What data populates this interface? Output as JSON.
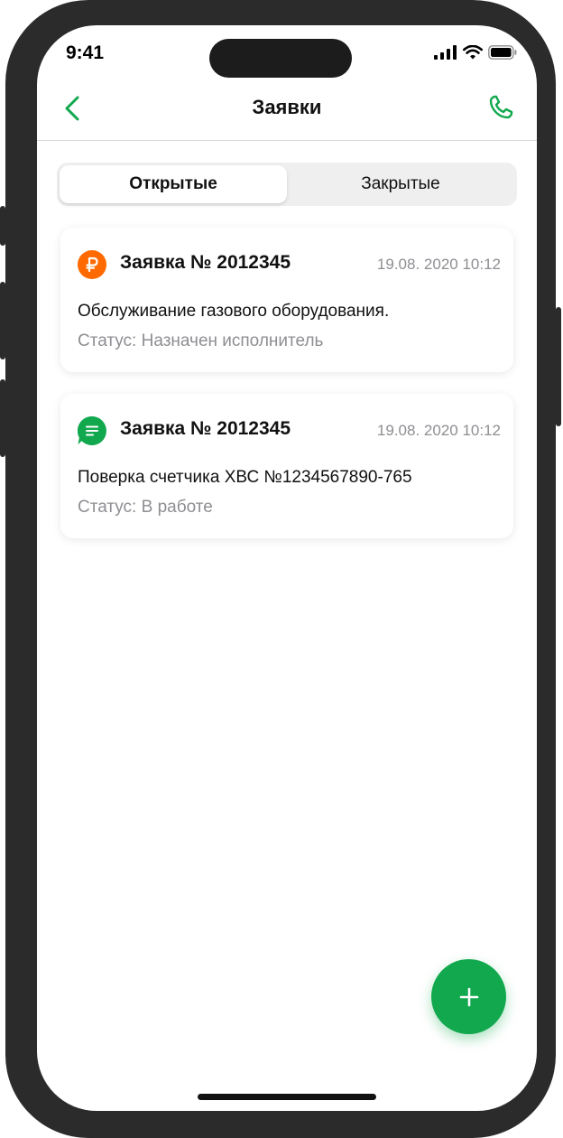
{
  "status_bar": {
    "time": "9:41"
  },
  "navbar": {
    "title": "Заявки",
    "back_icon": "chevron-left-icon",
    "call_icon": "phone-icon"
  },
  "tabs": [
    {
      "label": "Открытые",
      "active": true
    },
    {
      "label": "Закрытые",
      "active": false
    }
  ],
  "requests": [
    {
      "icon": "ruble-icon",
      "icon_color": "#FF6A00",
      "title": "Заявка № 2012345",
      "datetime": "19.08. 2020 10:12",
      "description": "Обслуживание газового оборудования.",
      "status": "Статус: Назначен исполнитель"
    },
    {
      "icon": "message-icon",
      "icon_color": "#11A84E",
      "title": "Заявка № 2012345",
      "datetime": "19.08. 2020 10:12",
      "description": "Поверка счетчика ХВС №1234567890-765",
      "status": "Статус: В работе"
    }
  ],
  "fab": {
    "icon": "plus-icon"
  },
  "colors": {
    "accent": "#11A84E",
    "muted_text": "#8E8E93"
  }
}
